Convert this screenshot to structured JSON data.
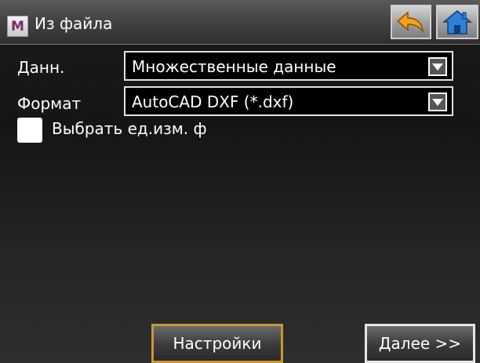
{
  "window": {
    "menu_button_label": "M",
    "title": "Из файла"
  },
  "toolbar": {
    "back_icon": "undo-arrow-icon",
    "home_icon": "home-icon",
    "accent_back": "#f2a31c",
    "accent_home": "#2f7fd6"
  },
  "form": {
    "data_label": "Данн.",
    "data_value": "Множественные данные",
    "format_label": "Формат",
    "format_value": "AutoCAD DXF (*.dxf)",
    "unit_checkbox_label": "Выбрать ед.изм. ф",
    "unit_checkbox_checked": false
  },
  "buttons": {
    "settings_label": "Настройки",
    "next_label": "Далее >>",
    "settings_border": "#c99833"
  }
}
